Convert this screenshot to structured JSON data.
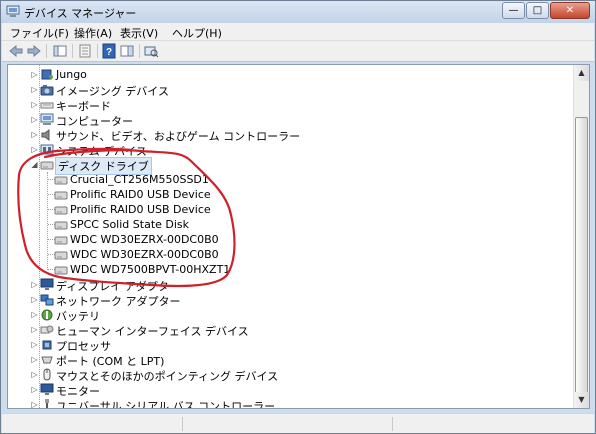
{
  "window": {
    "title": "デバイス マネージャー"
  },
  "menu": [
    {
      "label": "ファイル(F)"
    },
    {
      "label": "操作(A)"
    },
    {
      "label": "表示(V)"
    },
    {
      "label": "ヘルプ(H)"
    }
  ],
  "toolbar_icons": [
    "back-arrow-icon",
    "forward-arrow-icon",
    "show-hide-tree-icon",
    "properties-icon",
    "help-icon",
    "action-pane-icon",
    "scan-hardware-icon"
  ],
  "tree": {
    "categories_top": [
      {
        "label": "Jungo",
        "icon": "usb-icon"
      },
      {
        "label": "イメージング デバイス",
        "icon": "camera-icon"
      },
      {
        "label": "キーボード",
        "icon": "keyboard-icon"
      },
      {
        "label": "コンピューター",
        "icon": "computer-icon"
      },
      {
        "label": "サウンド、ビデオ、およびゲーム コントローラー",
        "icon": "speaker-icon"
      },
      {
        "label": "システム デバイス",
        "icon": "system-icon"
      }
    ],
    "disk_category": {
      "label": "ディスク ドライブ"
    },
    "disks": [
      {
        "label": "Crucial_CT256M550SSD1"
      },
      {
        "label": "Prolific RAID0 USB Device"
      },
      {
        "label": "Prolific RAID0 USB Device"
      },
      {
        "label": "SPCC Solid State Disk"
      },
      {
        "label": "WDC WD30EZRX-00DC0B0"
      },
      {
        "label": "WDC WD30EZRX-00DC0B0"
      },
      {
        "label": "WDC WD7500BPVT-00HXZT1"
      }
    ],
    "categories_bottom": [
      {
        "label": "ディスプレイ アダプター",
        "icon": "monitor-icon"
      },
      {
        "label": "ネットワーク アダプター",
        "icon": "network-icon"
      },
      {
        "label": "バッテリ",
        "icon": "battery-icon"
      },
      {
        "label": "ヒューマン インターフェイス デバイス",
        "icon": "hid-icon"
      },
      {
        "label": "プロセッサ",
        "icon": "processor-icon"
      },
      {
        "label": "ポート (COM と LPT)",
        "icon": "port-icon"
      },
      {
        "label": "マウスとそのほかのポインティング デバイス",
        "icon": "mouse-icon"
      },
      {
        "label": "モニター",
        "icon": "monitor-icon"
      },
      {
        "label": "ユニバーサル シリアル バス コントローラー",
        "icon": "usb-plug-icon"
      }
    ]
  },
  "annotation_color": "#d0202a"
}
